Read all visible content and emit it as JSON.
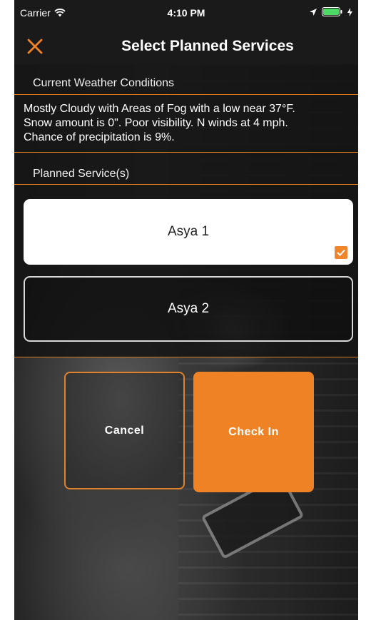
{
  "status_bar": {
    "carrier": "Carrier",
    "time": "4:10 PM",
    "wifi_icon": "wifi-icon",
    "location_icon": "location-arrow-icon",
    "battery_icon": "battery-icon",
    "charging_icon": "charging-bolt-icon",
    "battery_color": "#4cd964"
  },
  "nav": {
    "title": "Select Planned Services",
    "close_icon": "close-icon"
  },
  "weather": {
    "header": "Current Weather Conditions",
    "lines": [
      "Mostly Cloudy with Areas of Fog with a low near 37°F.",
      "Snow amount is 0\". Poor visibility. N winds at 4 mph.",
      "Chance of precipitation is 9%."
    ]
  },
  "services": {
    "header": "Planned Service(s)",
    "items": [
      {
        "label": "Asya 1",
        "selected": true
      },
      {
        "label": "Asya 2",
        "selected": false
      }
    ]
  },
  "actions": {
    "cancel_label": "Cancel",
    "check_in_label": "Check In"
  },
  "colors": {
    "accent": "#f08226",
    "header_bg": "#1a1a1a"
  }
}
